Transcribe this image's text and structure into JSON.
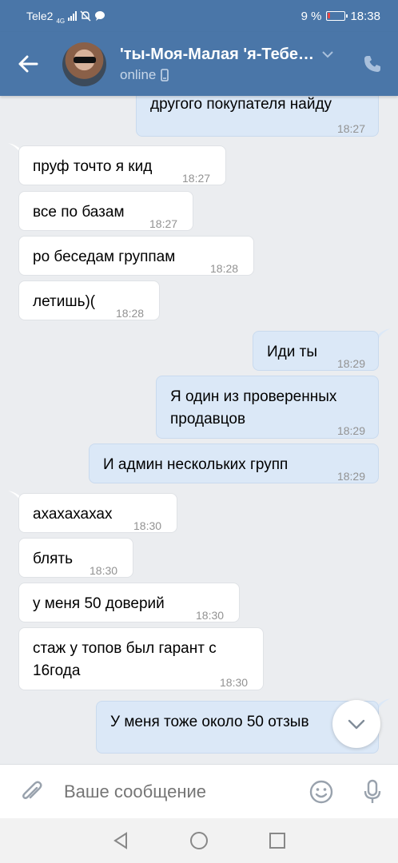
{
  "status_bar": {
    "carrier": "Tele2",
    "network": "4G",
    "battery": "9 %",
    "time": "18:38"
  },
  "header": {
    "title": "'ты-Моя-Малая 'я-Тебе…",
    "status": "online"
  },
  "messages": [
    {
      "dir": "out",
      "text": "другого покупателя найду",
      "time": "18:27"
    },
    {
      "dir": "in",
      "text": "пруф точто я кид",
      "time": "18:27"
    },
    {
      "dir": "in",
      "text": "все по базам",
      "time": "18:27"
    },
    {
      "dir": "in",
      "text": "ро беседам группам",
      "time": "18:28"
    },
    {
      "dir": "in",
      "text": "летишь)(",
      "time": "18:28"
    },
    {
      "dir": "out",
      "text": "Иди ты",
      "time": "18:29"
    },
    {
      "dir": "out",
      "text_line1": "Я один из проверенных",
      "text_line2": "продавцов",
      "time": "18:29"
    },
    {
      "dir": "out",
      "text": "И админ нескольких групп",
      "time": "18:29"
    },
    {
      "dir": "in",
      "text": "ахахахахах",
      "time": "18:30"
    },
    {
      "dir": "in",
      "text": "блять",
      "time": "18:30"
    },
    {
      "dir": "in",
      "text": "у меня 50 доверий",
      "time": "18:30"
    },
    {
      "dir": "in",
      "text_line1": "стаж у топов был гарант с",
      "text_line2": "16года",
      "time": "18:30"
    },
    {
      "dir": "out",
      "text": "У меня тоже около 50 отзыв"
    }
  ],
  "composer": {
    "placeholder": "Ваше сообщение"
  },
  "colors": {
    "header_bg": "#4a76a8",
    "outgoing_bubble": "#dbe8f7",
    "incoming_bubble": "#ffffff",
    "chat_bg": "#ebedf0"
  },
  "icons": [
    "back-arrow-icon",
    "chevron-down-icon",
    "phone-icon",
    "mobile-icon",
    "paperclip-icon",
    "smile-icon",
    "microphone-icon",
    "scroll-down-icon",
    "nav-back-icon",
    "nav-home-icon",
    "nav-recents-icon"
  ]
}
